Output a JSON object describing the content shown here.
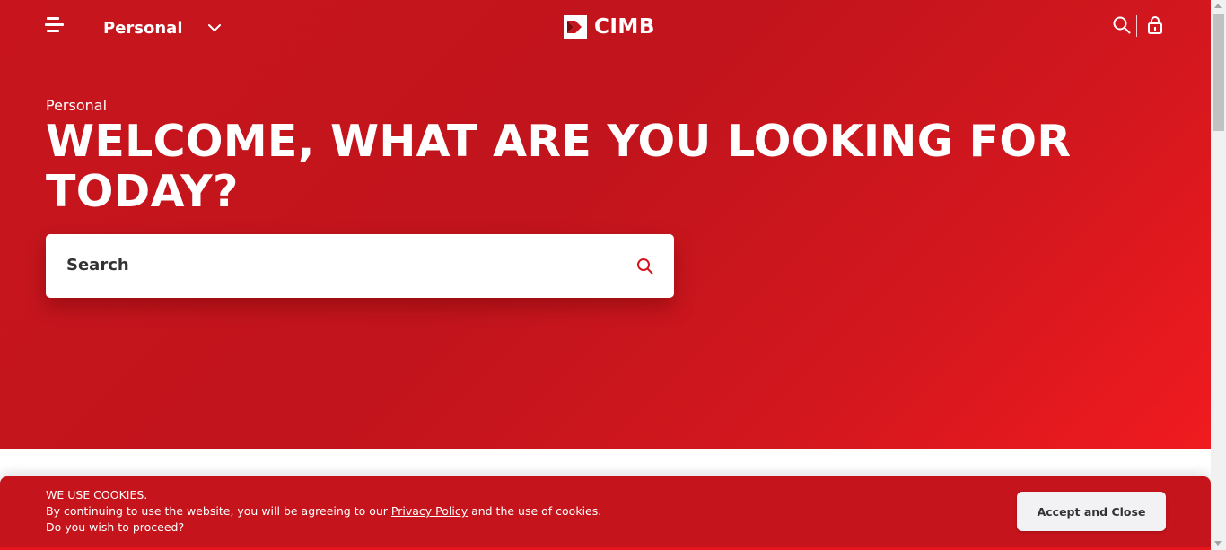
{
  "header": {
    "segment_label": "Personal",
    "logo_text": "CIMB",
    "icons": [
      "menu-icon",
      "chevron-down-icon",
      "search-icon",
      "lock-icon"
    ]
  },
  "hero": {
    "eyebrow": "Personal",
    "headline": "WELCOME, WHAT ARE YOU LOOKING FOR TODAY?",
    "search": {
      "placeholder": "Search"
    }
  },
  "cookie_banner": {
    "title": "WE USE COOKIES.",
    "line2_before": "By continuing to use the website, you will be agreeing to our ",
    "privacy_link": "Privacy Policy",
    "line2_after": " and the use of cookies.",
    "line3": "Do you wish to proceed?",
    "accept_label": "Accept and Close"
  },
  "colors": {
    "brand_red": "#c5141c",
    "white": "#ffffff"
  }
}
